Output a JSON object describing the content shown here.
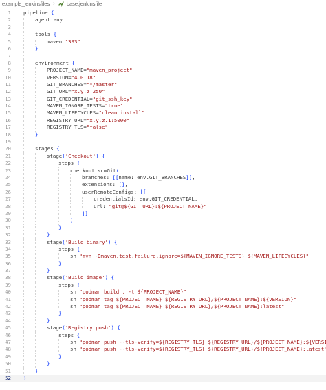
{
  "breadcrumb": {
    "folder": "example_jenkinsfiles",
    "file": "base.jenkinsfile",
    "separator": "›",
    "file_icon": "jenkinsfile-icon"
  },
  "editor": {
    "current_line": 52,
    "colors": {
      "text": "#3b3b3b",
      "string": "#a31515",
      "bracket": "#0431fa",
      "gutter": "#9a9a9a",
      "current_line_bg": "#f3f3f3"
    },
    "lines": [
      {
        "n": "1",
        "indent": 0,
        "tokens": [
          {
            "t": "pipeline "
          },
          {
            "p": "{"
          }
        ]
      },
      {
        "n": "2",
        "indent": 1,
        "tokens": [
          {
            "t": "agent any"
          }
        ]
      },
      {
        "n": "3",
        "indent": 1,
        "tokens": []
      },
      {
        "n": "4",
        "indent": 1,
        "tokens": [
          {
            "t": "tools "
          },
          {
            "p": "{"
          }
        ]
      },
      {
        "n": "5",
        "indent": 2,
        "tokens": [
          {
            "t": "maven "
          },
          {
            "s": "\"393\""
          }
        ]
      },
      {
        "n": "6",
        "indent": 1,
        "tokens": [
          {
            "p": "}"
          }
        ]
      },
      {
        "n": "7",
        "indent": 1,
        "tokens": []
      },
      {
        "n": "8",
        "indent": 1,
        "tokens": [
          {
            "t": "environment "
          },
          {
            "p": "{"
          }
        ]
      },
      {
        "n": "9",
        "indent": 2,
        "tokens": [
          {
            "t": "PROJECT_NAME="
          },
          {
            "s": "\"maven_project\""
          }
        ]
      },
      {
        "n": "10",
        "indent": 2,
        "tokens": [
          {
            "t": "VERSION="
          },
          {
            "s": "\"4.0.18\""
          }
        ]
      },
      {
        "n": "11",
        "indent": 2,
        "tokens": [
          {
            "t": "GIT_BRANCHES="
          },
          {
            "s": "\"*/master\""
          }
        ]
      },
      {
        "n": "12",
        "indent": 2,
        "tokens": [
          {
            "t": "GIT_URL="
          },
          {
            "s": "\"x.y.z.250\""
          }
        ]
      },
      {
        "n": "13",
        "indent": 2,
        "tokens": [
          {
            "t": "GIT_CREDENTIAL="
          },
          {
            "s": "\"git_ssh_key\""
          }
        ]
      },
      {
        "n": "14",
        "indent": 2,
        "tokens": [
          {
            "t": "MAVEN_IGNORE_TESTS="
          },
          {
            "s": "\"true\""
          }
        ]
      },
      {
        "n": "15",
        "indent": 2,
        "tokens": [
          {
            "t": "MAVEN_LIFECYCLES="
          },
          {
            "s": "\"clean install\""
          }
        ]
      },
      {
        "n": "16",
        "indent": 2,
        "tokens": [
          {
            "t": "REGISTRY_URL="
          },
          {
            "s": "\"x.y.z.1:5000\""
          }
        ]
      },
      {
        "n": "17",
        "indent": 2,
        "tokens": [
          {
            "t": "REGISTRY_TLS="
          },
          {
            "s": "\"false\""
          }
        ]
      },
      {
        "n": "18",
        "indent": 1,
        "tokens": [
          {
            "p": "}"
          }
        ]
      },
      {
        "n": "19",
        "indent": 1,
        "tokens": []
      },
      {
        "n": "20",
        "indent": 1,
        "tokens": [
          {
            "t": "stages "
          },
          {
            "p": "{"
          }
        ]
      },
      {
        "n": "21",
        "indent": 2,
        "tokens": [
          {
            "t": "stage"
          },
          {
            "p": "("
          },
          {
            "s": "'Checkout'"
          },
          {
            "p": ")"
          },
          {
            "t": " "
          },
          {
            "p": "{"
          }
        ]
      },
      {
        "n": "22",
        "indent": 3,
        "tokens": [
          {
            "t": "steps "
          },
          {
            "p": "{"
          }
        ]
      },
      {
        "n": "23",
        "indent": 4,
        "tokens": [
          {
            "t": "checkout scmGit"
          },
          {
            "p": "("
          }
        ]
      },
      {
        "n": "24",
        "indent": 5,
        "tokens": [
          {
            "t": "branches: "
          },
          {
            "p": "[["
          },
          {
            "t": "name: env.GIT_BRANCHES"
          },
          {
            "p": "]]"
          },
          {
            "t": ","
          }
        ]
      },
      {
        "n": "25",
        "indent": 5,
        "tokens": [
          {
            "t": "extensions: "
          },
          {
            "p": "[]"
          },
          {
            "t": ","
          }
        ]
      },
      {
        "n": "26",
        "indent": 5,
        "tokens": [
          {
            "t": "userRemoteConfigs: "
          },
          {
            "p": "[["
          }
        ]
      },
      {
        "n": "27",
        "indent": 6,
        "tokens": [
          {
            "t": "credentialsId: env.GIT_CREDENTIAL,"
          }
        ]
      },
      {
        "n": "28",
        "indent": 6,
        "tokens": [
          {
            "t": "url: "
          },
          {
            "s": "\"git@${GIT_URL}:${PROJECT_NAME}\""
          }
        ]
      },
      {
        "n": "29",
        "indent": 5,
        "tokens": [
          {
            "p": "]]"
          }
        ]
      },
      {
        "n": "30",
        "indent": 4,
        "tokens": [
          {
            "p": ")"
          }
        ]
      },
      {
        "n": "31",
        "indent": 3,
        "tokens": [
          {
            "p": "}"
          }
        ]
      },
      {
        "n": "32",
        "indent": 2,
        "tokens": [
          {
            "p": "}"
          }
        ]
      },
      {
        "n": "33",
        "indent": 2,
        "tokens": [
          {
            "t": "stage"
          },
          {
            "p": "("
          },
          {
            "s": "'Build binary'"
          },
          {
            "p": ")"
          },
          {
            "t": " "
          },
          {
            "p": "{"
          }
        ]
      },
      {
        "n": "34",
        "indent": 3,
        "tokens": [
          {
            "t": "steps "
          },
          {
            "p": "{"
          }
        ]
      },
      {
        "n": "35",
        "indent": 4,
        "tokens": [
          {
            "t": "sh "
          },
          {
            "s": "\"mvn -Dmaven.test.failure.ignore=${MAVEN_IGNORE_TESTS} ${MAVEN_LIFECYCLES}\""
          }
        ]
      },
      {
        "n": "36",
        "indent": 3,
        "tokens": [
          {
            "p": "}"
          }
        ]
      },
      {
        "n": "37",
        "indent": 2,
        "tokens": [
          {
            "p": "}"
          }
        ]
      },
      {
        "n": "38",
        "indent": 2,
        "tokens": [
          {
            "t": "stage"
          },
          {
            "p": "("
          },
          {
            "s": "'Build image'"
          },
          {
            "p": ")"
          },
          {
            "t": " "
          },
          {
            "p": "{"
          }
        ]
      },
      {
        "n": "39",
        "indent": 3,
        "tokens": [
          {
            "t": "steps "
          },
          {
            "p": "{"
          }
        ]
      },
      {
        "n": "40",
        "indent": 4,
        "tokens": [
          {
            "t": "sh "
          },
          {
            "s": "\"podman build . -t ${PROJECT_NAME}\""
          }
        ]
      },
      {
        "n": "41",
        "indent": 4,
        "tokens": [
          {
            "t": "sh "
          },
          {
            "s": "\"podman tag ${PROJECT_NAME} ${REGISTRY_URL}/${PROJECT_NAME}:${VERSION}\""
          }
        ]
      },
      {
        "n": "42",
        "indent": 4,
        "tokens": [
          {
            "t": "sh "
          },
          {
            "s": "\"podman tag ${PROJECT_NAME} ${REGISTRY_URL}/${PROJECT_NAME}:latest\""
          }
        ]
      },
      {
        "n": "43",
        "indent": 3,
        "tokens": [
          {
            "p": "}"
          }
        ]
      },
      {
        "n": "44",
        "indent": 2,
        "tokens": [
          {
            "p": "}"
          }
        ]
      },
      {
        "n": "45",
        "indent": 2,
        "tokens": [
          {
            "t": "stage"
          },
          {
            "p": "("
          },
          {
            "s": "'Registry push'"
          },
          {
            "p": ")"
          },
          {
            "t": " "
          },
          {
            "p": "{"
          }
        ]
      },
      {
        "n": "46",
        "indent": 3,
        "tokens": [
          {
            "t": "steps "
          },
          {
            "p": "{"
          }
        ]
      },
      {
        "n": "47",
        "indent": 4,
        "tokens": [
          {
            "t": "sh "
          },
          {
            "s": "\"podman push --tls-verify=${REGISTRY_TLS} ${REGISTRY_URL}/${PROJECT_NAME}:${VERSION}\""
          }
        ]
      },
      {
        "n": "48",
        "indent": 4,
        "tokens": [
          {
            "t": "sh "
          },
          {
            "s": "\"podman push --tls-verify=${REGISTRY_TLS} ${REGISTRY_URL}/${PROJECT_NAME}:latest\""
          }
        ]
      },
      {
        "n": "49",
        "indent": 3,
        "tokens": [
          {
            "p": "}"
          }
        ]
      },
      {
        "n": "50",
        "indent": 2,
        "tokens": [
          {
            "p": "}"
          }
        ]
      },
      {
        "n": "51",
        "indent": 1,
        "tokens": [
          {
            "p": "}"
          }
        ]
      },
      {
        "n": "52",
        "indent": 0,
        "tokens": [
          {
            "p": "}"
          }
        ]
      }
    ]
  }
}
